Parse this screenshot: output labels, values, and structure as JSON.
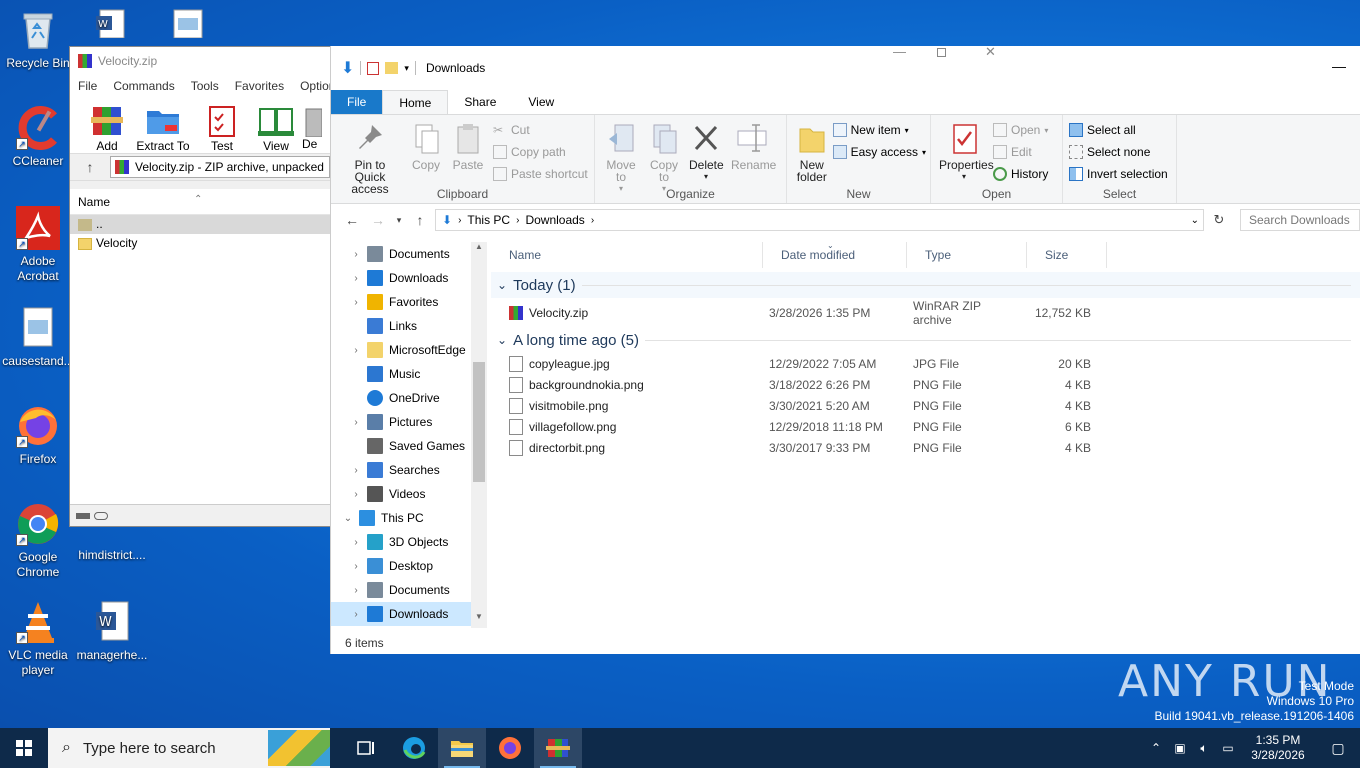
{
  "desktop": {
    "icons": [
      {
        "label": "Recycle Bin"
      },
      {
        "label": "CCleaner"
      },
      {
        "label": "Adobe Acrobat"
      },
      {
        "label": "causestand..."
      },
      {
        "label": "Firefox"
      },
      {
        "label": "Google Chrome"
      },
      {
        "label": "VLC media player"
      },
      {
        "label": "himdistrict...."
      },
      {
        "label": "managerhe..."
      }
    ],
    "watermark": {
      "logo": "ANY RUN",
      "line1": "Test Mode",
      "line2": "Windows 10 Pro",
      "line3": "Build 19041.vb_release.191206-1406"
    }
  },
  "winrar": {
    "title": "Velocity.zip",
    "menu": [
      "File",
      "Commands",
      "Tools",
      "Favorites",
      "Options"
    ],
    "toolbar": [
      "Add",
      "Extract To",
      "Test",
      "View",
      "De"
    ],
    "path": "Velocity.zip - ZIP archive, unpacked",
    "column_name": "Name",
    "rows": [
      "..",
      "Velocity"
    ]
  },
  "explorer": {
    "title": "Downloads",
    "tabs": [
      "File",
      "Home",
      "Share",
      "View"
    ],
    "ribbon": {
      "clipboard": {
        "label": "Clipboard",
        "pin": "Pin to Quick access",
        "copy": "Copy",
        "paste": "Paste",
        "cut": "Cut",
        "copy_path": "Copy path",
        "paste_shortcut": "Paste shortcut"
      },
      "organize": {
        "label": "Organize",
        "move_to": "Move to",
        "copy_to": "Copy to",
        "delete": "Delete",
        "rename": "Rename"
      },
      "new": {
        "label": "New",
        "new_folder": "New folder",
        "new_item": "New item",
        "easy_access": "Easy access"
      },
      "open": {
        "label": "Open",
        "properties": "Properties",
        "open": "Open",
        "edit": "Edit",
        "history": "History"
      },
      "select": {
        "label": "Select",
        "select_all": "Select all",
        "select_none": "Select none",
        "invert": "Invert selection"
      }
    },
    "breadcrumb": [
      "This PC",
      "Downloads"
    ],
    "search_placeholder": "Search Downloads",
    "nav": [
      {
        "label": "Documents",
        "icon": "documents-icon"
      },
      {
        "label": "Downloads",
        "icon": "downloads-icon"
      },
      {
        "label": "Favorites",
        "icon": "star-icon"
      },
      {
        "label": "Links",
        "icon": "links-icon"
      },
      {
        "label": "MicrosoftEdge",
        "icon": "folder-icon"
      },
      {
        "label": "Music",
        "icon": "music-icon"
      },
      {
        "label": "OneDrive",
        "icon": "cloud-icon"
      },
      {
        "label": "Pictures",
        "icon": "pictures-icon"
      },
      {
        "label": "Saved Games",
        "icon": "games-icon"
      },
      {
        "label": "Searches",
        "icon": "search-icon"
      },
      {
        "label": "Videos",
        "icon": "videos-icon"
      },
      {
        "label": "This PC",
        "icon": "pc-icon"
      },
      {
        "label": "3D Objects",
        "icon": "cube-icon"
      },
      {
        "label": "Desktop",
        "icon": "desktop-icon"
      },
      {
        "label": "Documents",
        "icon": "documents-icon"
      },
      {
        "label": "Downloads",
        "icon": "downloads-icon"
      }
    ],
    "columns": [
      "Name",
      "Date modified",
      "Type",
      "Size"
    ],
    "groups": [
      {
        "title": "Today (1)",
        "files": [
          {
            "name": "Velocity.zip",
            "date": "3/28/2026 1:35 PM",
            "type": "WinRAR ZIP archive",
            "size": "12,752 KB"
          }
        ]
      },
      {
        "title": "A long time ago (5)",
        "files": [
          {
            "name": "copyleague.jpg",
            "date": "12/29/2022 7:05 AM",
            "type": "JPG File",
            "size": "20 KB"
          },
          {
            "name": "backgroundnokia.png",
            "date": "3/18/2022 6:26 PM",
            "type": "PNG File",
            "size": "4 KB"
          },
          {
            "name": "visitmobile.png",
            "date": "3/30/2021 5:20 AM",
            "type": "PNG File",
            "size": "4 KB"
          },
          {
            "name": "villagefollow.png",
            "date": "12/29/2018 11:18 PM",
            "type": "PNG File",
            "size": "6 KB"
          },
          {
            "name": "directorbit.png",
            "date": "3/30/2017 9:33 PM",
            "type": "PNG File",
            "size": "4 KB"
          }
        ]
      }
    ],
    "status": "6 items"
  },
  "taskbar": {
    "search_placeholder": "Type here to search",
    "time": "1:35 PM",
    "date": "3/28/2026"
  }
}
